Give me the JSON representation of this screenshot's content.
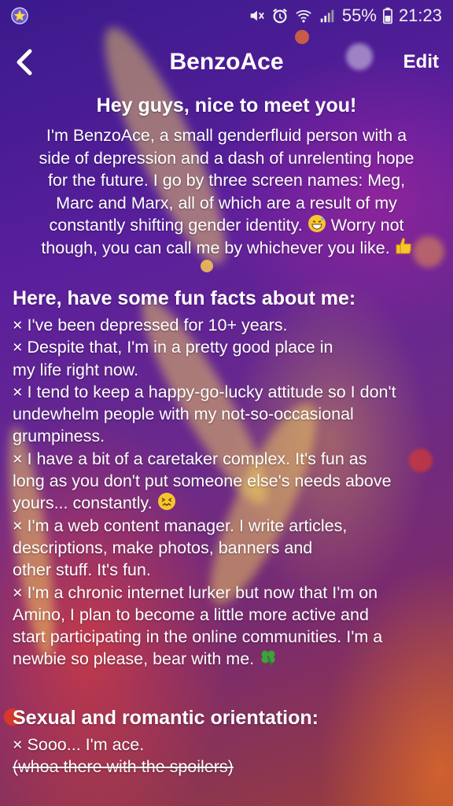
{
  "status_bar": {
    "battery": "55%",
    "time": "21:23"
  },
  "nav": {
    "title": "BenzoAce",
    "edit_label": "Edit"
  },
  "intro": {
    "heading": "Hey guys, nice to meet you!",
    "line1": "I'm BenzoAce, a small genderfluid person with a",
    "line2": "side of depression and a dash of unrelenting hope",
    "line3": "for the future. I go by three screen names: Meg,",
    "line4": "Marc and Marx, all of which are a result of my",
    "line5a": "constantly shifting gender identity. ",
    "line5b": " Worry not",
    "line6a": "though, you can call me by whichever you like. "
  },
  "facts": {
    "heading": "Here, have some fun facts about me:",
    "f1": "× I've been depressed for 10+ years.",
    "f2a": "× Despite that, I'm in a pretty good place in",
    "f2b": "my life right now.",
    "f3a": "× I tend to keep a happy-go-lucky attitude so I don't",
    "f3b": "undewhelm people with my not-so-occasional",
    "f3c": "grumpiness.",
    "f4a": "× I have a bit of a caretaker complex. It's fun as",
    "f4b": "long as you don't put someone else's needs above",
    "f4c": "yours... constantly. ",
    "f5a": "× I'm a web content manager. I write articles,",
    "f5b": "descriptions, make photos, banners and",
    "f5c": "other stuff. It's fun.",
    "f6a": "× I'm a chronic internet lurker but now that I'm on",
    "f6b": "Amino, I plan to become a little more active and",
    "f6c": "start participating in the online communities. I'm a",
    "f6d": "newbie so please, bear with me. "
  },
  "orientation": {
    "heading": "Sexual and romantic orientation:",
    "o1": "× Sooo... I'm ace.",
    "o2": "(whoa there with the spoilers)"
  },
  "icons": {
    "app": "star-icon",
    "mute": "mute-icon",
    "alarm": "alarm-icon",
    "wifi": "wifi-icon",
    "signal": "signal-icon",
    "battery": "battery-icon",
    "back": "back-arrow-icon",
    "emoji_sweat": "grinning-sweat-emoji-icon",
    "emoji_thumb": "thumbs-up-emoji-icon",
    "emoji_confounded": "confounded-face-emoji-icon",
    "emoji_clover": "four-leaf-clover-emoji-icon"
  },
  "colors": {
    "text": "#ffffff",
    "emoji_yellow": "#f7c531",
    "clover_green": "#3aa33a"
  }
}
